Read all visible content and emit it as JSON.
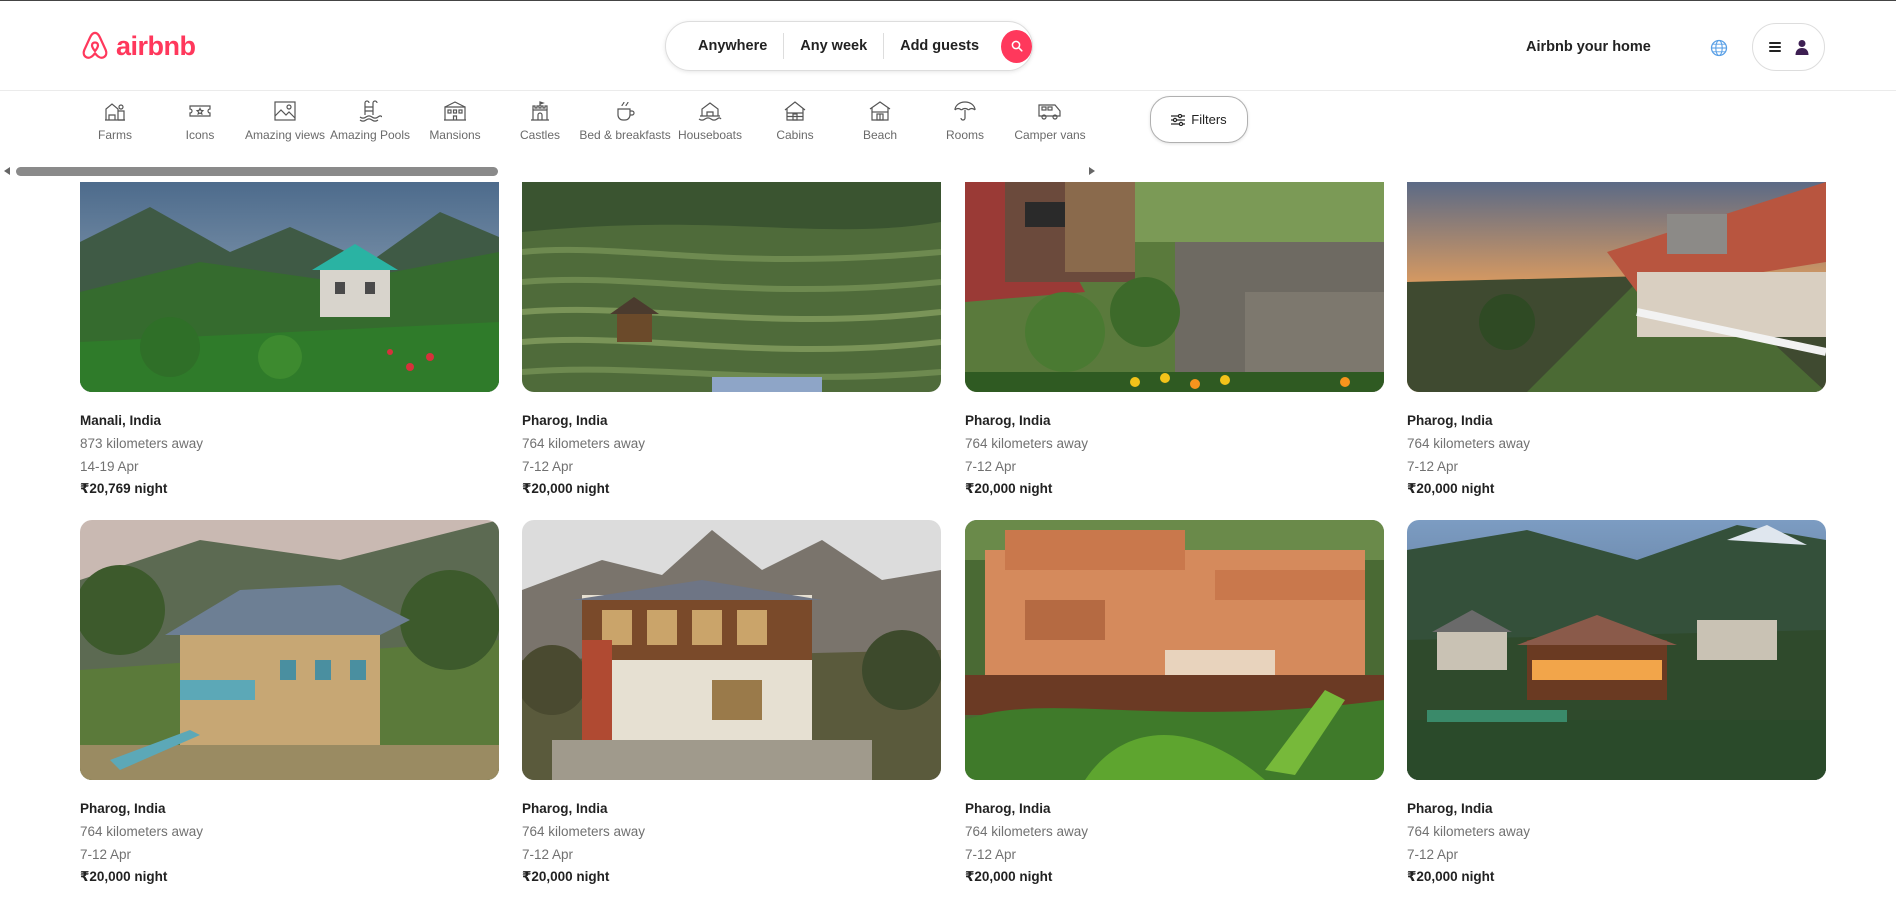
{
  "brand": {
    "name": "airbnb",
    "color": "#ff385c"
  },
  "search": {
    "where": "Anywhere",
    "when": "Any week",
    "who": "Add guests",
    "button_icon": "search-icon"
  },
  "header": {
    "host_link": "Airbnb your home",
    "globe_icon": "globe-icon",
    "menu_icon": "hamburger-icon",
    "avatar_icon": "user-avatar-icon"
  },
  "categories": [
    {
      "label": "Farms",
      "icon": "farm-icon"
    },
    {
      "label": "Icons",
      "icon": "ticket-icon"
    },
    {
      "label": "Amazing views",
      "icon": "view-picture-icon"
    },
    {
      "label": "Amazing Pools",
      "icon": "pool-icon"
    },
    {
      "label": "Mansions",
      "icon": "mansion-icon"
    },
    {
      "label": "Castles",
      "icon": "castle-icon"
    },
    {
      "label": "Bed & breakfasts",
      "icon": "breakfast-icon"
    },
    {
      "label": "Houseboats",
      "icon": "houseboat-icon"
    },
    {
      "label": "Cabins",
      "icon": "cabin-icon"
    },
    {
      "label": "Beach",
      "icon": "beach-hut-icon"
    },
    {
      "label": "Rooms",
      "icon": "umbrella-icon"
    },
    {
      "label": "Camper vans",
      "icon": "camper-van-icon"
    }
  ],
  "filters": {
    "label": "Filters",
    "icon": "sliders-icon"
  },
  "listings": [
    {
      "location": "Manali, India",
      "distance": "873 kilometers away",
      "dates": "14-19 Apr",
      "price": "₹20,769 night"
    },
    {
      "location": "Pharog, India",
      "distance": "764 kilometers away",
      "dates": "7-12 Apr",
      "price": "₹20,000 night"
    },
    {
      "location": "Pharog, India",
      "distance": "764 kilometers away",
      "dates": "7-12 Apr",
      "price": "₹20,000 night"
    },
    {
      "location": "Pharog, India",
      "distance": "764 kilometers away",
      "dates": "7-12 Apr",
      "price": "₹20,000 night"
    },
    {
      "location": "Pharog, India",
      "distance": "764 kilometers away",
      "dates": "7-12 Apr",
      "price": "₹20,000 night"
    },
    {
      "location": "Pharog, India",
      "distance": "764 kilometers away",
      "dates": "7-12 Apr",
      "price": "₹20,000 night"
    },
    {
      "location": "Pharog, India",
      "distance": "764 kilometers away",
      "dates": "7-12 Apr",
      "price": "₹20,000 night"
    },
    {
      "location": "Pharog, India",
      "distance": "764 kilometers away",
      "dates": "7-12 Apr",
      "price": "₹20,000 night"
    }
  ]
}
